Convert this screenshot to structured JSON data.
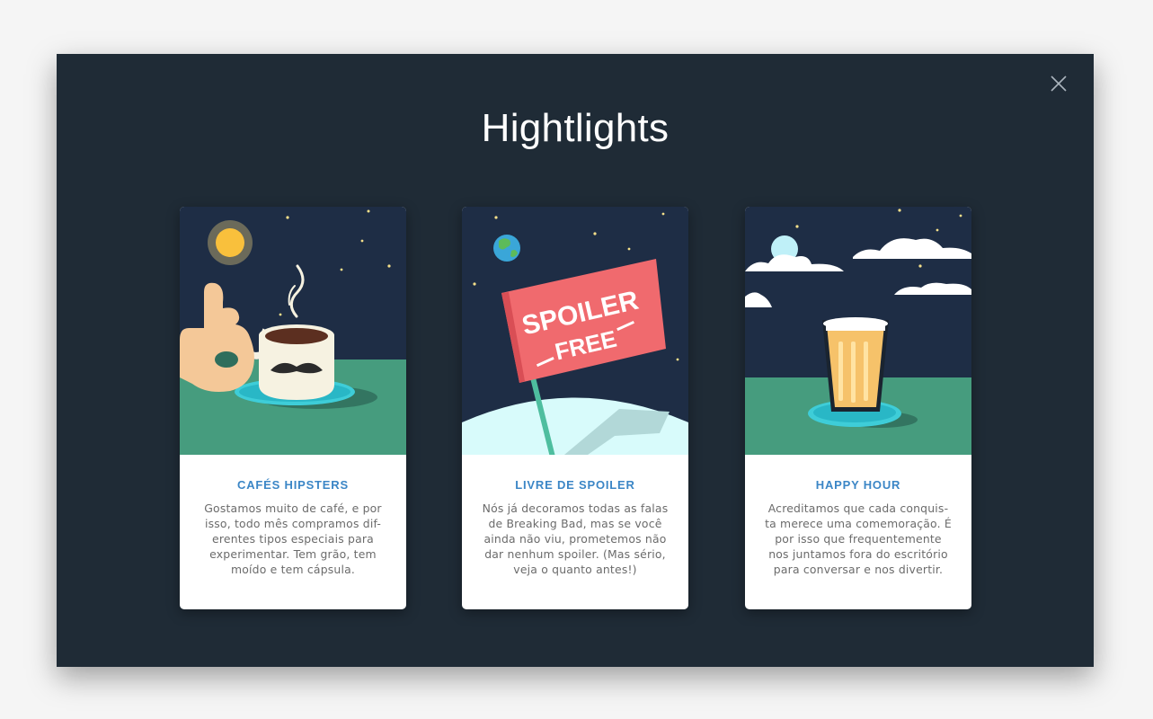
{
  "modal": {
    "title": "Hightlights",
    "close_icon": "close-icon"
  },
  "colors": {
    "background": "#1f2b36",
    "accent": "#3b86c6",
    "card_bg": "#ffffff"
  },
  "cards": [
    {
      "title": "CAFÉS HIPSTERS",
      "text": "Gostamos muito de café, e por isso, todo mês compramos dif-erentes tipos especiais para experimentar. Tem grão, tem moído e tem cápsula.",
      "illustration": "coffee-mug-icon"
    },
    {
      "title": "LIVRE DE SPOILER",
      "text": "Nós já decoramos todas as falas de Breaking Bad, mas se você ainda não viu, prometemos não dar nenhum spoiler. (Mas sério, veja o quanto antes!)",
      "illustration": "spoiler-flag-icon",
      "flag_line1": "SPOILER",
      "flag_line2": "FREE"
    },
    {
      "title": "HAPPY HOUR",
      "text": "Acreditamos que cada conquis-ta merece uma comemoração. É por isso que frequentemente nos juntamos fora do escritório para conversar e nos divertir.",
      "illustration": "beer-glass-icon"
    }
  ]
}
